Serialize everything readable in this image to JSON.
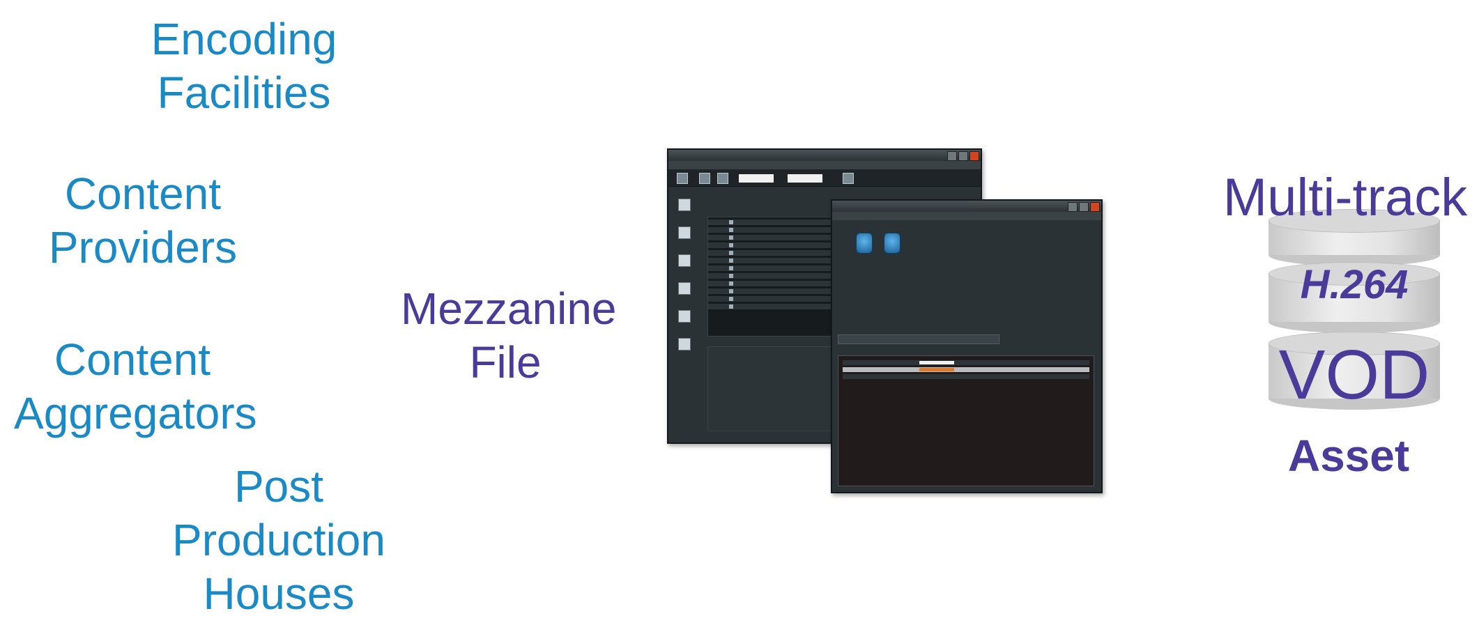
{
  "sources": {
    "encoding": [
      "Encoding",
      "Facilities"
    ],
    "providers": [
      "Content",
      "Providers"
    ],
    "aggregators": [
      "Content",
      "Aggregators"
    ],
    "post": [
      "Post",
      "Production",
      "Houses"
    ]
  },
  "mezzanine": [
    "Mezzanine",
    "File"
  ],
  "asset": {
    "multitrack": "Multi-track",
    "codec": "H.264",
    "vod": "VOD",
    "asset": "Asset"
  },
  "colors": {
    "source_text": "#1a8ac6",
    "asset_text": "#4a3a99"
  }
}
